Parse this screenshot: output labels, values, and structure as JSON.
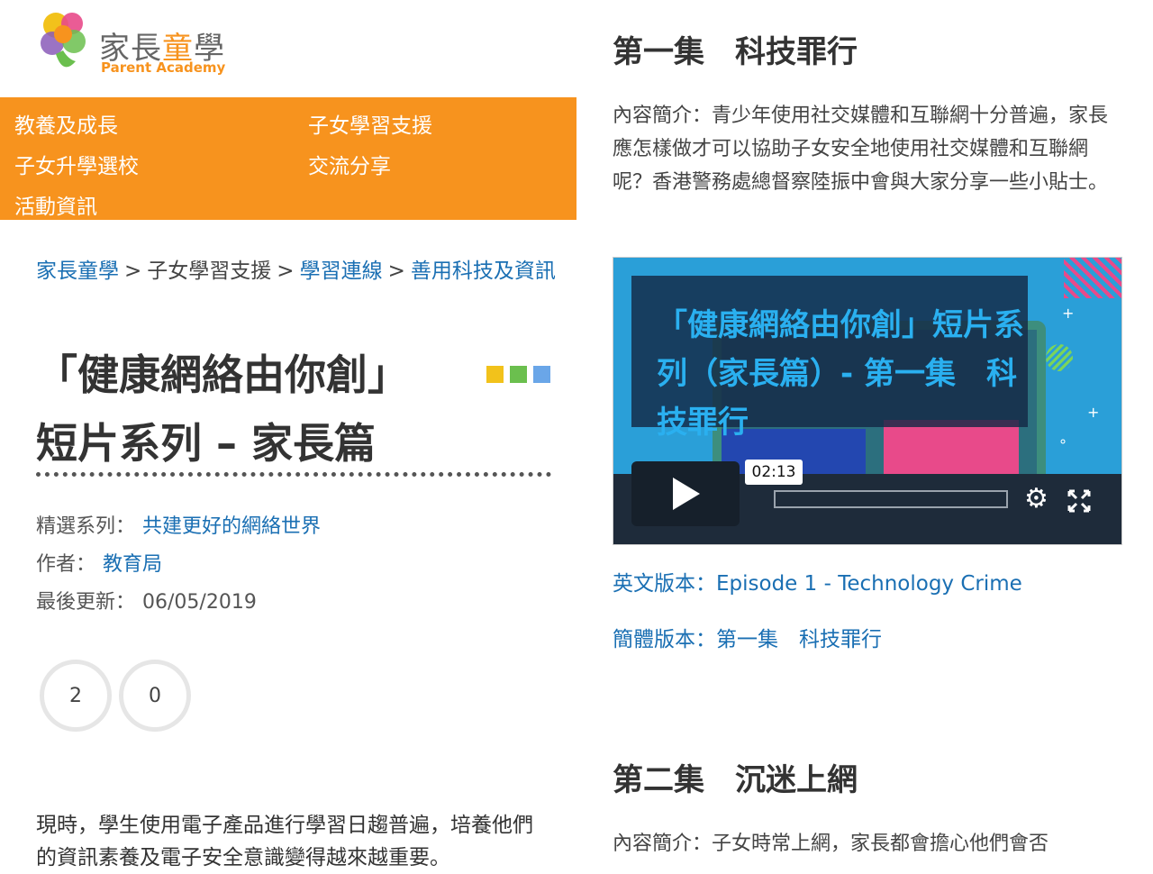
{
  "logo": {
    "cn_1": "家長",
    "cn_2": "童",
    "cn_3": "學",
    "en": "Parent Academy"
  },
  "nav": {
    "items": [
      {
        "label": "教養及成長"
      },
      {
        "label": "子女學習支援"
      },
      {
        "label": "子女升學選校"
      },
      {
        "label": "交流分享"
      },
      {
        "label": "活動資訊"
      }
    ]
  },
  "breadcrumb": {
    "items": [
      {
        "label": "家長童學",
        "link": true
      },
      {
        "label": "子女學習支援",
        "link": false
      },
      {
        "label": "學習連線",
        "link": true
      },
      {
        "label": "善用科技及資訊",
        "link": true
      }
    ],
    "separator": ">"
  },
  "page": {
    "title": "「健康網絡由你創」短片系列 – 家長篇",
    "square_colors": [
      "#f2c21b",
      "#6bbf4e",
      "#6aa6e8"
    ]
  },
  "meta": {
    "series_label": "精選系列：",
    "series_value": "共建更好的網絡世界",
    "author_label": "作者：",
    "author_value": "教育局",
    "updated_label": "最後更新：",
    "updated_value": "06/05/2019"
  },
  "reactions": {
    "likes": "2",
    "comments": "0"
  },
  "intro": {
    "text": "現時，學生使用電子產品進行學習日趨普遍，培養他們的資訊素養及電子安全意識變得越來越重要。"
  },
  "episode1": {
    "title": "第一集　科技罪行",
    "desc": "內容簡介：青少年使用社交媒體和互聯網十分普遍，家長應怎樣做才可以協助子女安全地使用社交媒體和互聯網呢？香港警務處總督察陸振中會與大家分享一些小貼士。",
    "video": {
      "caption": "「健康網絡由你創」短片系列（家長篇）- 第一集　科技罪行",
      "time": "02:13",
      "play_icon": "play-icon",
      "settings_icon": "gear-icon",
      "fullscreen_icon": "fullscreen-icon"
    },
    "english_version": "英文版本：Episode 1 - Technology Crime",
    "simplified_version": "簡體版本：第一集　科技罪行"
  },
  "episode2": {
    "title": "第二集　沉迷上網",
    "desc": "內容簡介：子女時常上網，家長都會擔心他們會否"
  }
}
